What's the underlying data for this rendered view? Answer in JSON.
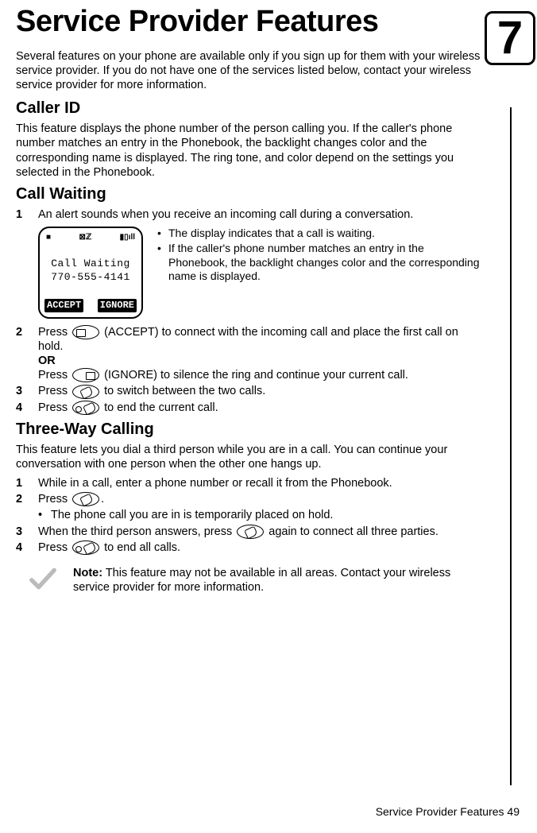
{
  "chapter_number": "7",
  "title": "Service Provider Features",
  "intro": "Several features on your phone are available only if you sign up for them with your wireless service provider. If you do not have one of the services listed below, contact your wireless service provider for more information.",
  "caller_id": {
    "heading": "Caller ID",
    "body": "This feature displays the phone number of the person calling you. If the caller's phone number matches an entry in the Phonebook, the backlight changes color and the corresponding name is displayed. The ring tone, and color depend on the settings you selected in the Phonebook."
  },
  "call_waiting": {
    "heading": "Call Waiting",
    "step1": "An alert sounds when you receive an incoming call during a conversation.",
    "display": {
      "status_left": "■",
      "status_mid": "⊠ℤ",
      "status_right": "▮▯ıll",
      "line1": "Call Waiting",
      "line2": "770-555-4141",
      "soft_left": "ACCEPT",
      "soft_right": "IGNORE"
    },
    "side_bullet1": "The display indicates that a call is waiting.",
    "side_bullet2": "If the caller's phone number matches an entry in the Phonebook, the backlight changes color and the corresponding name is displayed.",
    "step2a_pre": "Press ",
    "step2a_post": " (ACCEPT) to connect with the incoming call and place the first call on hold.",
    "or": "OR",
    "step2b_pre": "Press ",
    "step2b_post": " (IGNORE) to silence the ring and continue your current call.",
    "step3_pre": "Press ",
    "step3_post": " to switch between the two calls.",
    "step4_pre": "Press ",
    "step4_post": " to end the current call."
  },
  "three_way": {
    "heading": "Three-Way Calling",
    "body": "This feature lets you dial a third person while you are in a call. You can continue your conversation with one person when the other one hangs up.",
    "step1": "While in a call, enter a phone number or recall it from the Phonebook.",
    "step2_pre": "Press ",
    "step2_post": ".",
    "step2_sub": "The phone call you are in is temporarily placed on hold.",
    "step3_pre": "When the third person answers, press ",
    "step3_post": " again to connect all three parties.",
    "step4_pre": "Press ",
    "step4_post": " to end all calls."
  },
  "note": {
    "label": "Note:",
    "text": " This feature may not be available in all areas. Contact your wireless service provider for more information."
  },
  "footer": "Service Provider Features    49",
  "nums": {
    "n1": "1",
    "n2": "2",
    "n3": "3",
    "n4": "4"
  },
  "bullet": "•"
}
